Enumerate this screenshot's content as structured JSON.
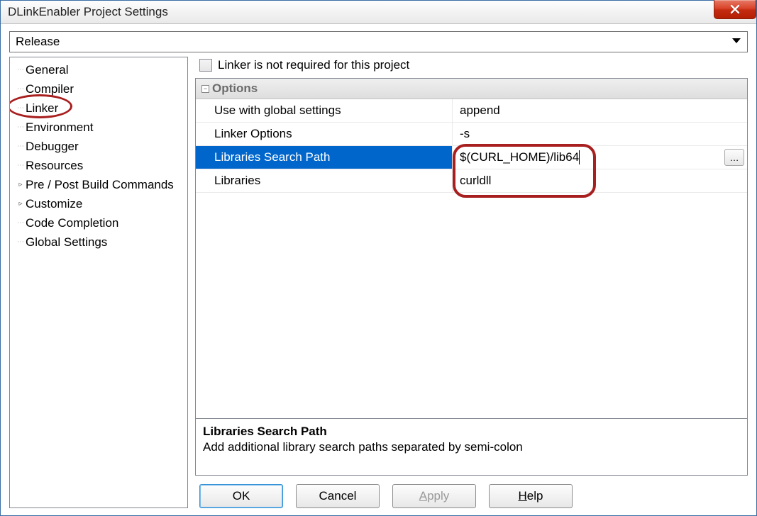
{
  "window": {
    "title": "DLinkEnabler Project Settings"
  },
  "config_dropdown": {
    "value": "Release"
  },
  "sidebar": {
    "items": [
      {
        "label": "General",
        "expand": ""
      },
      {
        "label": "Compiler",
        "expand": ""
      },
      {
        "label": "Linker",
        "expand": ""
      },
      {
        "label": "Environment",
        "expand": ""
      },
      {
        "label": "Debugger",
        "expand": ""
      },
      {
        "label": "Resources",
        "expand": ""
      },
      {
        "label": "Pre / Post Build Commands",
        "expand": "▹"
      },
      {
        "label": "Customize",
        "expand": "▹"
      },
      {
        "label": "Code Completion",
        "expand": ""
      },
      {
        "label": "Global Settings",
        "expand": ""
      }
    ],
    "selected_index": 2
  },
  "checkbox": {
    "label": "Linker is not required for this project",
    "checked": false
  },
  "options": {
    "title": "Options",
    "rows": [
      {
        "key": "Use with global settings",
        "value": "append"
      },
      {
        "key": "Linker Options",
        "value": "-s"
      },
      {
        "key": "Libraries Search Path",
        "value": "$(CURL_HOME)/lib64"
      },
      {
        "key": "Libraries",
        "value": "curldll"
      }
    ],
    "selected_index": 2
  },
  "description": {
    "title": "Libraries Search Path",
    "text": "Add additional library search paths separated by semi-colon"
  },
  "buttons": {
    "ok": "OK",
    "cancel": "Cancel",
    "apply": "Apply",
    "help": "Help"
  }
}
